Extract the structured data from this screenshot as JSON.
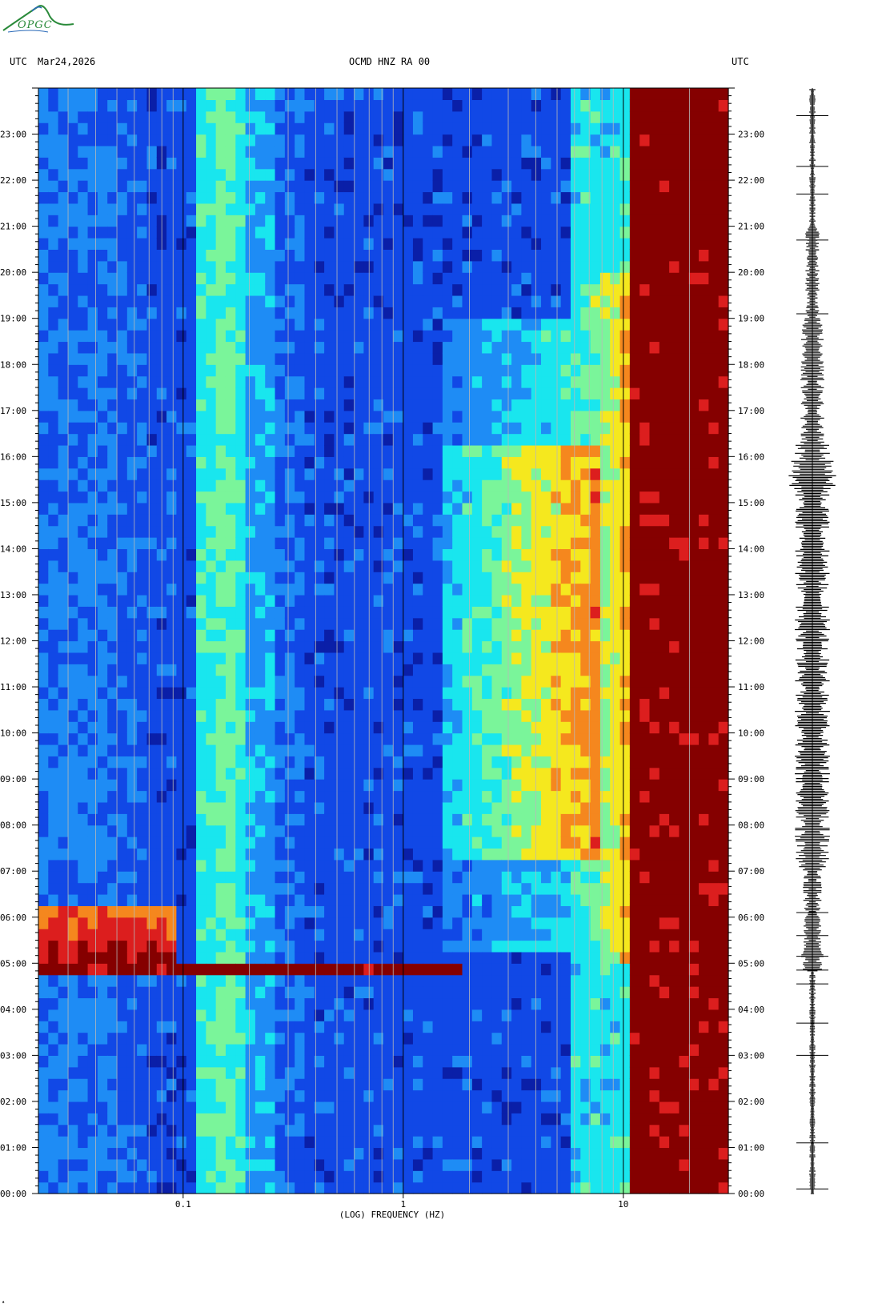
{
  "header": {
    "left_tz": "UTC",
    "date": "Mar24,2026",
    "station": "OCMD HNZ RA 00",
    "right_tz": "UTC"
  },
  "logo": {
    "text": "OPGC"
  },
  "colors": {
    "dark_blue": "#0a1fa8",
    "blue": "#1148e6",
    "light_blue": "#1e8cf5",
    "cyan": "#19e6ee",
    "green": "#7af59a",
    "yellow": "#f5e81e",
    "orange": "#f5871e",
    "red": "#dc1e1e",
    "dark_red": "#850000"
  },
  "chart_data": {
    "type": "heatmap",
    "title": "OCMD HNZ RA 00",
    "xlabel": "(LOG) FREQUENCY (HZ)",
    "x_scale": "log",
    "xlim": [
      0.022,
      30
    ],
    "x_ticks": [
      {
        "value": 0.1,
        "label": "0.1"
      },
      {
        "value": 1,
        "label": "1"
      },
      {
        "value": 10,
        "label": "10"
      }
    ],
    "ylim_hours": [
      0,
      24
    ],
    "y_tick_labels": [
      "00:00",
      "01:00",
      "02:00",
      "03:00",
      "04:00",
      "05:00",
      "06:00",
      "07:00",
      "08:00",
      "09:00",
      "10:00",
      "11:00",
      "12:00",
      "13:00",
      "14:00",
      "15:00",
      "16:00",
      "17:00",
      "18:00",
      "19:00",
      "20:00",
      "21:00",
      "22:00",
      "23:00"
    ],
    "grid": true,
    "colormap": "jet",
    "events": [
      {
        "time_hours": 4.95,
        "description": "strong broadband arrival"
      }
    ],
    "waveform_trace": true
  }
}
